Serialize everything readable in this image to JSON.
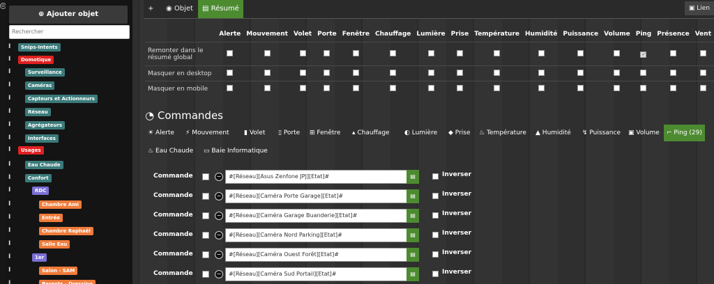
{
  "sidebar": {
    "add_label": "Ajouter objet",
    "search_placeholder": "Rechercher",
    "tree": [
      {
        "label": "Snips-Intents",
        "color": "#3b7a7a"
      },
      {
        "label": "Domotique",
        "color": "#e02020"
      },
      {
        "label": "Surveillance",
        "color": "#3b7a7a"
      },
      {
        "label": "Caméras",
        "color": "#3b7a7a"
      },
      {
        "label": "Capteurs et Actionneurs",
        "color": "#3b7a7a"
      },
      {
        "label": "Réseau",
        "color": "#3b7a7a"
      },
      {
        "label": "Agrégateurs",
        "color": "#3b7a7a"
      },
      {
        "label": "Interfaces",
        "color": "#3b7a7a"
      },
      {
        "label": "Usages",
        "color": "#e02020"
      },
      {
        "label": "Eau Chaude",
        "color": "#3b7a7a"
      },
      {
        "label": "Confort",
        "color": "#3b7a7a"
      },
      {
        "label": "RDC",
        "color": "#7b6fd6"
      },
      {
        "label": "Chambre Ami",
        "color": "#f07b3a"
      },
      {
        "label": "Entrée",
        "color": "#f07b3a"
      },
      {
        "label": "Chambre Raphaël",
        "color": "#f07b3a"
      },
      {
        "label": "Salle Eau",
        "color": "#f07b3a"
      },
      {
        "label": "1er",
        "color": "#7b6fd6"
      },
      {
        "label": "Salon - SAM",
        "color": "#f07b3a"
      },
      {
        "label": "Parents - Dressing",
        "color": "#f07b3a"
      }
    ]
  },
  "topbar": {
    "plus": "+",
    "tabs": [
      "Objet",
      "Résumé"
    ],
    "active_tab": "Résumé",
    "link_label": "Lien"
  },
  "resume": {
    "columns": [
      "Alerte",
      "Mouvement",
      "Volet",
      "Porte",
      "Fenêtre",
      "Chauffage",
      "Lumière",
      "Prise",
      "Température",
      "Humidité",
      "Puissance",
      "Volume",
      "Ping",
      "Présence",
      "Vent"
    ],
    "rows": [
      {
        "label": "Remonter dans le résumé global",
        "checked": [
          "Ping"
        ]
      },
      {
        "label": "Masquer en desktop",
        "checked": []
      },
      {
        "label": "Masquer en mobile",
        "checked": []
      }
    ]
  },
  "commandes": {
    "title": "Commandes",
    "categories": [
      "Alerte",
      "Mouvement",
      "Volet",
      "Porte",
      "Fenêtre",
      "Chauffage",
      "Lumière",
      "Prise",
      "Température",
      "Humidité",
      "Puissance",
      "Volume",
      "Ping (29)",
      "Eau Chaude",
      "Baie Informatique"
    ],
    "active_category": "Ping (29)",
    "row_label": "Commande",
    "invert_label": "Inverser",
    "items": [
      "#[Réseau][Asus Zenfone JPJ][Etat]#",
      "#[Réseau][Caméra Porte Garage][Etat]#",
      "#[Réseau][Caméra Garage Buanderie][Etat]#",
      "#[Réseau][Caméra Nord Parking][Etat]#",
      "#[Réseau][Caméra Ouest Forêt][Etat]#",
      "#[Réseau][Caméra Sud Portail][Etat]#"
    ]
  }
}
